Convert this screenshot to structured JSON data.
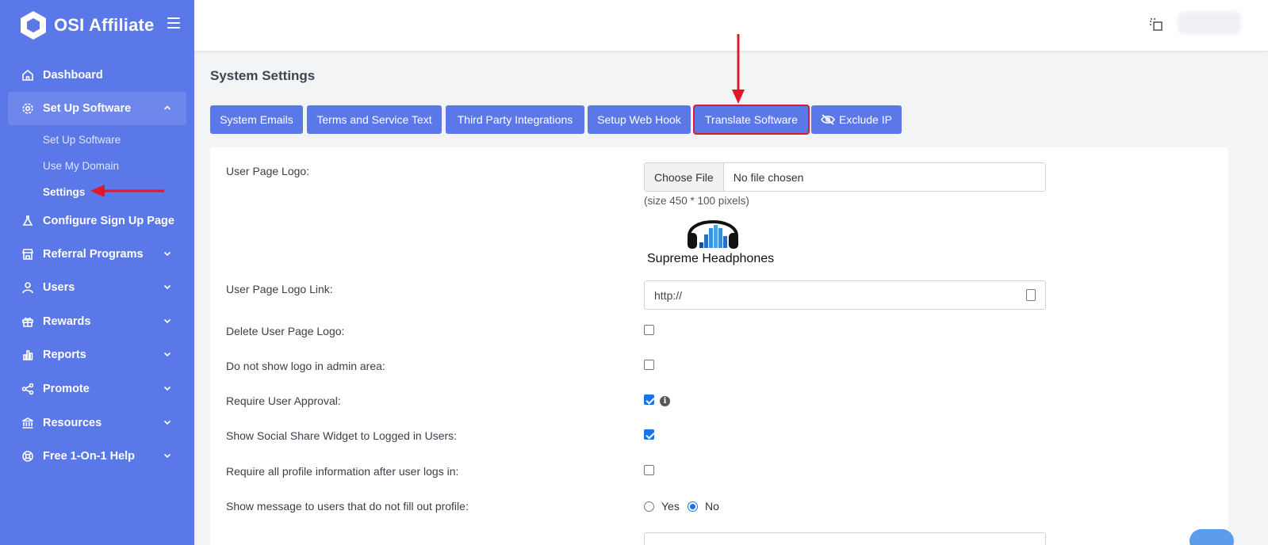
{
  "app": {
    "name": "OSI Affiliate"
  },
  "sidebar": {
    "items": [
      {
        "label": "Dashboard",
        "icon": "home-icon"
      },
      {
        "label": "Set Up Software",
        "icon": "gear-icon",
        "expanded": true
      },
      {
        "label": "Configure Sign Up Page",
        "icon": "flask-icon"
      },
      {
        "label": "Referral Programs",
        "icon": "store-icon"
      },
      {
        "label": "Users",
        "icon": "user-icon"
      },
      {
        "label": "Rewards",
        "icon": "gift-icon"
      },
      {
        "label": "Reports",
        "icon": "bar-chart-icon"
      },
      {
        "label": "Promote",
        "icon": "share-icon"
      },
      {
        "label": "Resources",
        "icon": "bank-icon"
      },
      {
        "label": "Free 1-On-1 Help",
        "icon": "lifebuoy-icon"
      }
    ],
    "subitems": [
      {
        "label": "Set Up Software"
      },
      {
        "label": "Use My Domain"
      },
      {
        "label": "Settings",
        "current": true
      }
    ]
  },
  "page": {
    "title": "System Settings"
  },
  "tabs": [
    {
      "label": "System Emails"
    },
    {
      "label": "Terms and Service Text"
    },
    {
      "label": "Third Party Integrations"
    },
    {
      "label": "Setup Web Hook"
    },
    {
      "label": "Translate Software",
      "highlighted": true
    },
    {
      "label": "Exclude IP",
      "icon": "eye-slash-icon"
    }
  ],
  "form": {
    "user_page_logo": {
      "label": "User Page Logo:",
      "choose_file": "Choose File",
      "file_status": "No file chosen",
      "hint": "(size 450 * 100 pixels)",
      "logo_caption": "Supreme Headphones"
    },
    "logo_link": {
      "label": "User Page Logo Link:",
      "value": "http://"
    },
    "delete_logo": {
      "label": "Delete User Page Logo:",
      "checked": false
    },
    "hide_logo_admin": {
      "label": "Do not show logo in admin area:",
      "checked": false
    },
    "require_approval": {
      "label": "Require User Approval:",
      "checked": true
    },
    "social_share": {
      "label": "Show Social Share Widget to Logged in Users:",
      "checked": true
    },
    "require_profile": {
      "label": "Require all profile information after user logs in:",
      "checked": false
    },
    "show_message": {
      "label": "Show message to users that do not fill out profile:",
      "options": [
        "Yes",
        "No"
      ],
      "selected": "No"
    }
  },
  "colors": {
    "sidebar": "#5b78e8",
    "primary_button": "#5b78e8",
    "annotation_arrow": "#e0192a",
    "checkbox_checked": "#1a73e8"
  }
}
